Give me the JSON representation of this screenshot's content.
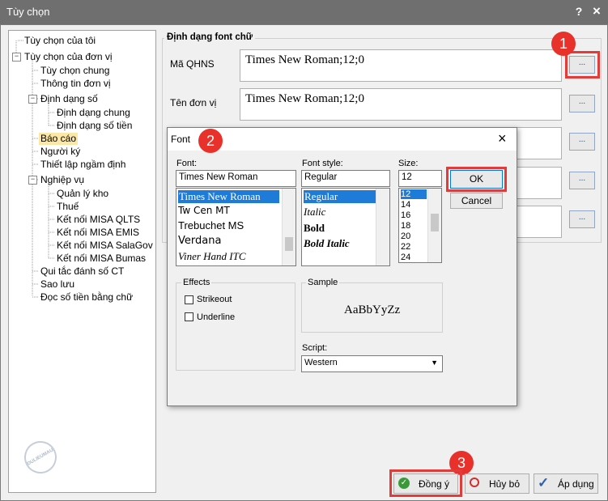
{
  "window": {
    "title": "Tùy chọn",
    "help_label": "?",
    "close_label": "×"
  },
  "tree": [
    {
      "label": "Tùy chọn của tôi"
    },
    {
      "label": "Tùy chọn của đơn vị"
    },
    {
      "label": "Tùy chọn chung"
    },
    {
      "label": "Thông tin đơn vị"
    },
    {
      "label": "Định dạng số"
    },
    {
      "label": "Định dạng chung"
    },
    {
      "label": "Định dạng số tiền"
    },
    {
      "label": "Báo cáo"
    },
    {
      "label": "Người ký"
    },
    {
      "label": "Thiết lập ngầm định"
    },
    {
      "label": "Nghiệp vụ"
    },
    {
      "label": "Quản lý kho"
    },
    {
      "label": "Thuế"
    },
    {
      "label": "Kết nối MISA QLTS"
    },
    {
      "label": "Kết nối MISA EMIS"
    },
    {
      "label": "Kết nối MISA SalaGov"
    },
    {
      "label": "Kết nối MISA Bumas"
    },
    {
      "label": "Qui tắc đánh số CT"
    },
    {
      "label": "Sao lưu"
    },
    {
      "label": "Đọc số tiền bằng chữ"
    }
  ],
  "tree_toggles": [
    "−",
    "−",
    "−"
  ],
  "font_group": {
    "title": "Định dạng font chữ",
    "fields": [
      {
        "label": "Mã QHNS",
        "value": "Times New Roman;12;0"
      },
      {
        "label": "Tên đơn vị",
        "value": "Times New Roman;12;0"
      }
    ],
    "ellipsis_label": "..."
  },
  "badges": [
    "1",
    "2",
    "3"
  ],
  "font_dialog": {
    "title": "Font",
    "close_label": "×",
    "font_label": "Font:",
    "font_value": "Times New Roman",
    "fonts": [
      "Times New Roman",
      "Tw Cen MT",
      "Trebuchet MS",
      "Verdana",
      "Viner Hand ITC"
    ],
    "style_label": "Font style:",
    "style_value": "Regular",
    "styles": [
      "Regular",
      "Italic",
      "Bold",
      "Bold Italic"
    ],
    "size_label": "Size:",
    "size_value": "12",
    "sizes": [
      "12",
      "14",
      "16",
      "18",
      "20",
      "22",
      "24"
    ],
    "ok_label": "OK",
    "cancel_label": "Cancel",
    "effects_label": "Effects",
    "strikeout_label": "Strikeout",
    "underline_label": "Underline",
    "sample_label": "Sample",
    "sample_text": "AaBbYyZz",
    "script_label": "Script:",
    "script_value": "Western"
  },
  "footer": {
    "ok_label": "Đồng ý",
    "cancel_label": "Hủy bỏ",
    "apply_label": "Áp dụng"
  },
  "watermark": "DULIEUMAU",
  "colors": {
    "titlebar": "#6f6f6f",
    "selection": "#1e7bd8",
    "highlight_node": "#fbe8a6",
    "badge": "#e8312a"
  }
}
